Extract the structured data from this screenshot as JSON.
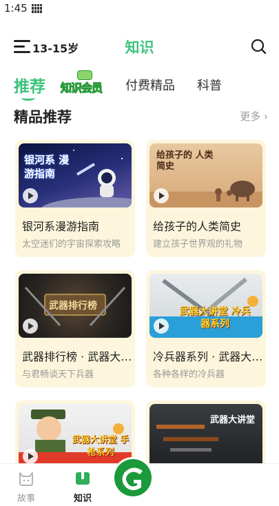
{
  "status_bar": {
    "time": "1:45"
  },
  "header": {
    "age_filter": "13-15岁",
    "title": "知识"
  },
  "tabs": [
    {
      "label": "推荐",
      "active": true
    },
    {
      "label": "知识会员",
      "active": false
    },
    {
      "label": "付费精品",
      "active": false
    },
    {
      "label": "科普",
      "active": false
    }
  ],
  "section": {
    "title": "精品推荐",
    "more_label": "更多",
    "more_arrow": "›"
  },
  "cards": [
    {
      "title": "银河系漫游指南",
      "subtitle": "太空迷们的宇宙探索攻略",
      "thumb_caption": "银河系 漫游指南",
      "icon": "play-icon"
    },
    {
      "title": "给孩子的人类简史",
      "subtitle": "建立孩子世界观的礼物",
      "thumb_caption": "给孩子的 人类简史",
      "icon": "play-icon"
    },
    {
      "title": "武器排行榜 · 武器大讲堂",
      "subtitle": "与君畅谈天下兵器",
      "thumb_caption": "武器排行榜",
      "icon": "play-icon"
    },
    {
      "title": "冷兵器系列 · 武器大讲堂",
      "subtitle": "各种各样的冷兵器",
      "thumb_caption": "武器大讲堂 冷兵器系列",
      "icon": "play-icon"
    },
    {
      "title": "",
      "subtitle": "",
      "thumb_caption": "武器大讲堂 手枪系列",
      "icon": "play-icon"
    },
    {
      "title": "",
      "subtitle": "",
      "thumb_caption": "武器大讲堂",
      "icon": ""
    }
  ],
  "bottom_nav": [
    {
      "label": "故事",
      "icon": "cat-icon",
      "active": false
    },
    {
      "label": "知识",
      "icon": "book-icon",
      "active": true
    }
  ],
  "colors": {
    "accent": "#3cc47c",
    "card_bg": "#fdf6dc",
    "brand": "#1a9a3a"
  }
}
